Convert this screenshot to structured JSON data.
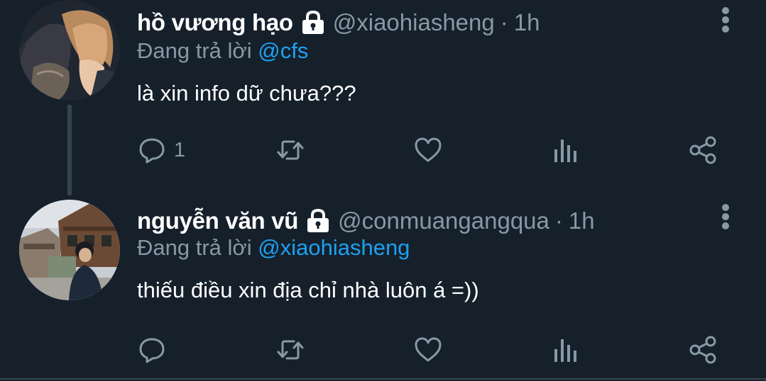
{
  "tweets": [
    {
      "name": "hồ vương hạo",
      "handle": "@xiaohiasheng",
      "separator": "·",
      "time": "1h",
      "replying_prefix": "Đang trả lời",
      "replying_to": "@cfs",
      "text": "là xin info dữ chưa???",
      "reply_count": "1",
      "protected_icon": "lock-icon"
    },
    {
      "name": "nguyễn văn vũ",
      "handle": "@conmuangangqua",
      "separator": "·",
      "time": "1h",
      "replying_prefix": "Đang trả lời",
      "replying_to": "@xiaohiasheng",
      "text": "thiếu điều xin địa chỉ nhà luôn á =))",
      "reply_count": "",
      "protected_icon": "lock-icon"
    }
  ],
  "icons": [
    "reply-icon",
    "retweet-icon",
    "like-icon",
    "analytics-icon",
    "share-icon",
    "more-options-icon"
  ],
  "colors": {
    "background": "#15202b",
    "primary_text": "#ffffff",
    "secondary_text": "#8899a6",
    "mention": "#1da1f2",
    "divider": "#38444d"
  }
}
